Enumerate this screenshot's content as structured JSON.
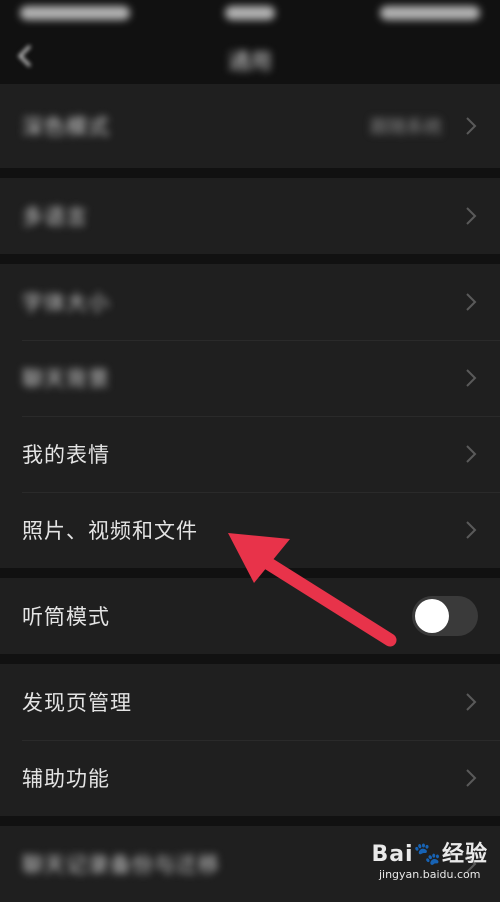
{
  "status_bar": {
    "carrier": "",
    "time": "",
    "battery": ""
  },
  "nav": {
    "title": "通用",
    "back_icon": "chevron-left-icon"
  },
  "groups": [
    {
      "items": [
        {
          "label": "深色模式",
          "value": "跟随系统",
          "blurred": true
        }
      ]
    },
    {
      "items": [
        {
          "label": "多语言",
          "blurred": true
        }
      ]
    },
    {
      "items": [
        {
          "label": "字体大小",
          "blurred": true
        },
        {
          "label": "聊天背景",
          "blurred": true
        },
        {
          "label": "我的表情"
        },
        {
          "label": "照片、视频和文件"
        }
      ]
    },
    {
      "items": [
        {
          "label": "听筒模式",
          "toggle": false
        }
      ]
    },
    {
      "items": [
        {
          "label": "发现页管理"
        },
        {
          "label": "辅助功能"
        }
      ]
    },
    {
      "items": [
        {
          "label": "聊天记录备份与迁移",
          "blurred": true
        }
      ]
    }
  ],
  "annotation": {
    "arrow_color": "#e8334a",
    "points_to": "照片、视频和文件"
  },
  "watermark": {
    "logo": "Bai🐾经验",
    "url": "jingyan.baidu.com"
  }
}
